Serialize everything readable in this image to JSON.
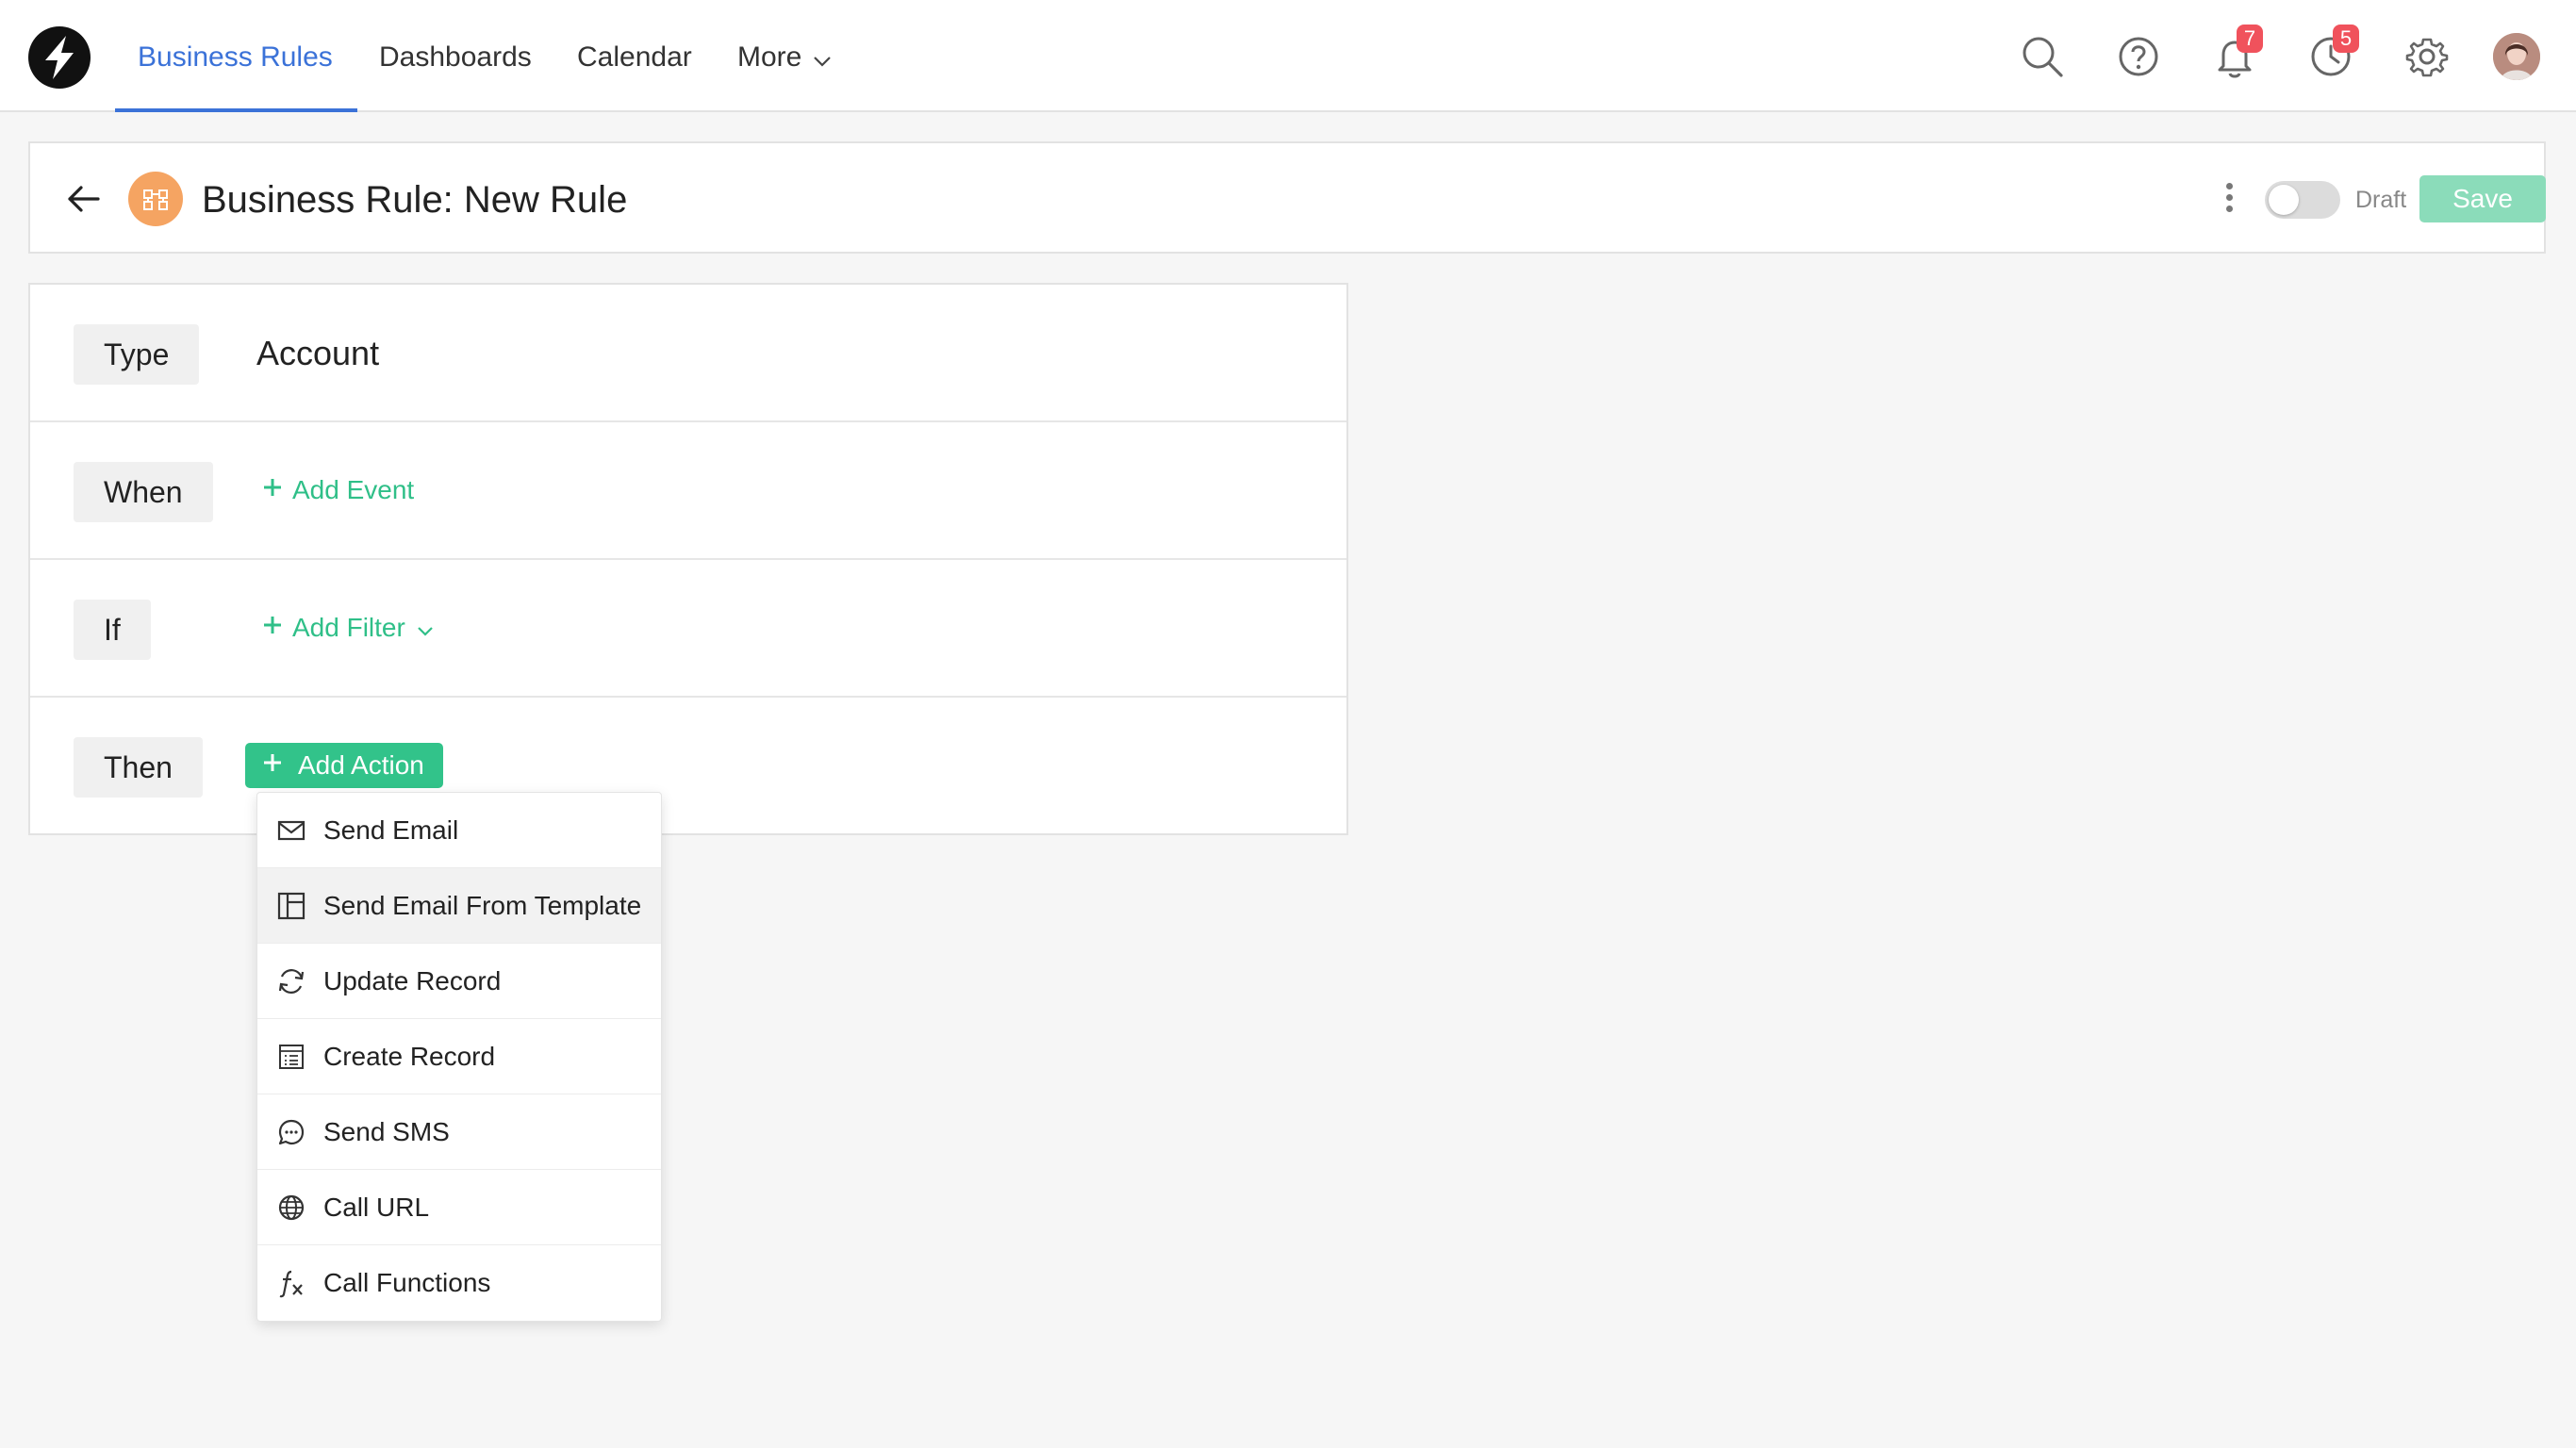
{
  "nav": {
    "tabs": [
      {
        "label": "Business Rules",
        "active": true
      },
      {
        "label": "Dashboards",
        "active": false
      },
      {
        "label": "Calendar",
        "active": false
      },
      {
        "label": "More",
        "active": false
      }
    ],
    "accent_color": "#3b72d8",
    "notifications_count": "7",
    "reminders_count": "5",
    "icons": [
      "search-icon",
      "help-icon",
      "bell-icon",
      "clock-icon",
      "gear-icon"
    ]
  },
  "header": {
    "title": "Business Rule: New Rule",
    "status_label": "Draft",
    "save_label": "Save",
    "save_color": "#8bdcba"
  },
  "rule": {
    "type_label": "Type",
    "type_value": "Account",
    "when_label": "When",
    "add_event_label": "Add Event",
    "if_label": "If",
    "add_filter_label": "Add Filter",
    "then_label": "Then",
    "add_action_label": "Add Action",
    "action_color": "#32c38a"
  },
  "action_menu": {
    "items": [
      {
        "label": "Send Email",
        "icon": "envelope-icon"
      },
      {
        "label": "Send Email From Template",
        "icon": "template-icon"
      },
      {
        "label": "Update Record",
        "icon": "refresh-icon"
      },
      {
        "label": "Create Record",
        "icon": "record-icon"
      },
      {
        "label": "Send SMS",
        "icon": "chat-icon"
      },
      {
        "label": "Call URL",
        "icon": "globe-icon"
      },
      {
        "label": "Call Functions",
        "icon": "function-icon"
      }
    ]
  }
}
